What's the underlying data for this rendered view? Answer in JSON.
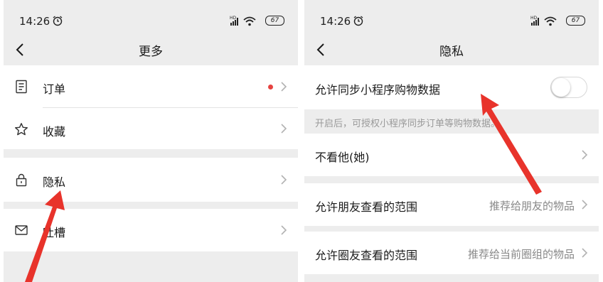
{
  "left_screen": {
    "status": {
      "time": "14:26",
      "battery": "67"
    },
    "title": "更多",
    "items": [
      {
        "label": "订单"
      },
      {
        "label": "收藏"
      },
      {
        "label": "隐私"
      },
      {
        "label": "吐槽"
      }
    ]
  },
  "right_screen": {
    "status": {
      "time": "14:26",
      "battery": "67"
    },
    "title": "隐私",
    "sync_label": "允许同步小程序购物数据",
    "sync_hint": "开启后，可授权小程序同步订单等购物数据。",
    "rows": [
      {
        "label": "不看他(她)",
        "value": ""
      },
      {
        "label": "允许朋友查看的范围",
        "value": "推荐给朋友的物品"
      },
      {
        "label": "允许圈友查看的范围",
        "value": "推荐给当前圈组的物品"
      }
    ]
  },
  "colors": {
    "accent_red": "#e64340",
    "background": "#ededed"
  }
}
